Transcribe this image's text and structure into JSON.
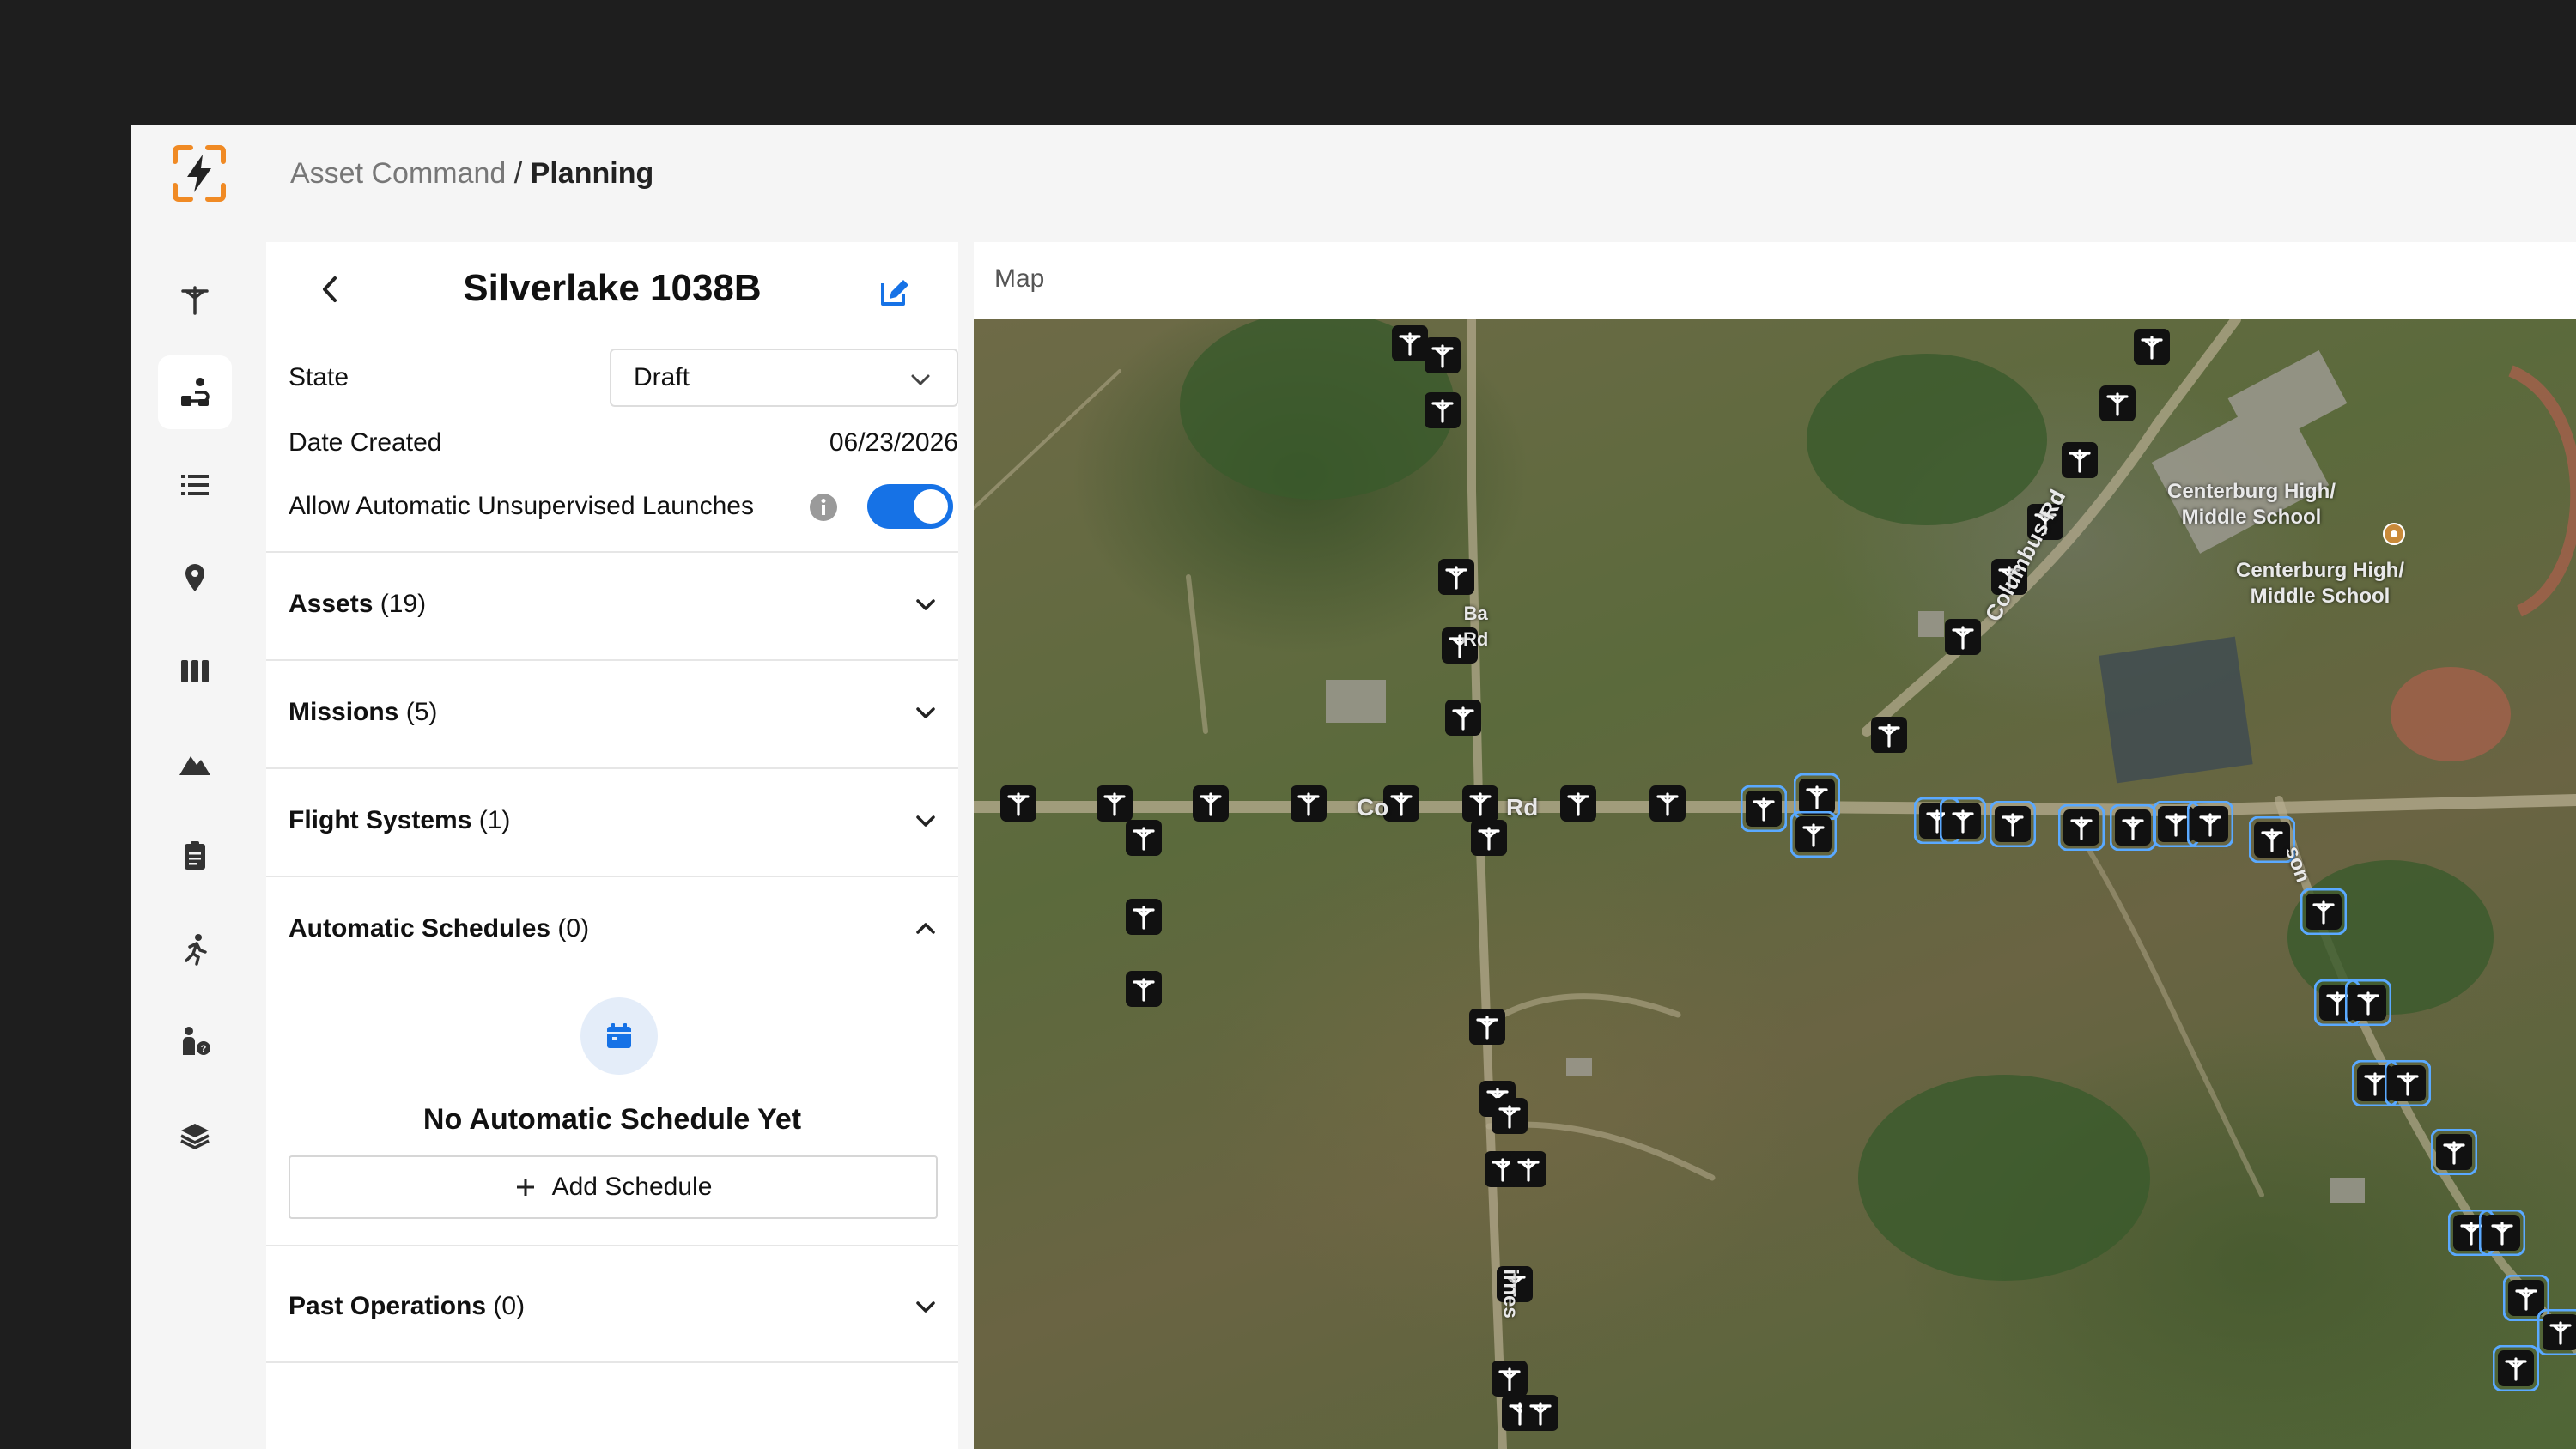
{
  "header": {
    "parent": "Asset Command",
    "separator": " / ",
    "current": "Planning"
  },
  "rail": [
    {
      "icon": "utility-pole-icon",
      "active": false
    },
    {
      "icon": "drone-route-icon",
      "active": true
    },
    {
      "icon": "list-icon",
      "active": false
    },
    {
      "icon": "location-pin-icon",
      "active": false
    },
    {
      "icon": "columns-icon",
      "active": false
    },
    {
      "icon": "mountain-icon",
      "active": false
    },
    {
      "icon": "clipboard-icon",
      "active": false
    },
    {
      "icon": "running-person-icon",
      "active": false
    },
    {
      "icon": "person-help-icon",
      "active": false
    },
    {
      "icon": "layers-icon",
      "active": false
    }
  ],
  "panel": {
    "title": "Silverlake 1038B",
    "state_label": "State",
    "state_value": "Draft",
    "date_label": "Date Created",
    "date_value": "06/23/2026",
    "auto_launch_label": "Allow Automatic Unsupervised Launches",
    "auto_launch_enabled": true,
    "sections": [
      {
        "name": "Assets",
        "count": "(19)",
        "expanded": false
      },
      {
        "name": "Missions",
        "count": "(5)",
        "expanded": false
      },
      {
        "name": "Flight Systems",
        "count": "(1)",
        "expanded": false
      },
      {
        "name": "Automatic Schedules",
        "count": "(0)",
        "expanded": true
      },
      {
        "name": "Past Operations",
        "count": "(0)",
        "expanded": false
      }
    ],
    "empty_schedule_title": "No Automatic Schedule Yet",
    "add_schedule_label": "Add Schedule"
  },
  "map": {
    "title": "Map",
    "labels": {
      "school_1": "Centerburg High/\nMiddle School",
      "school_2": "Centerburg High/\nMiddle School",
      "road_columbus": "Columbus Rd",
      "road_ba": "Ba\nRd",
      "road_co": "Co",
      "road_rd": "Rd",
      "road_son": "son",
      "road_irnes": "irnes"
    }
  },
  "colors": {
    "accent": "#1672e6",
    "logo_orange": "#f08a24",
    "selected_pin": "#5aa9ff"
  }
}
